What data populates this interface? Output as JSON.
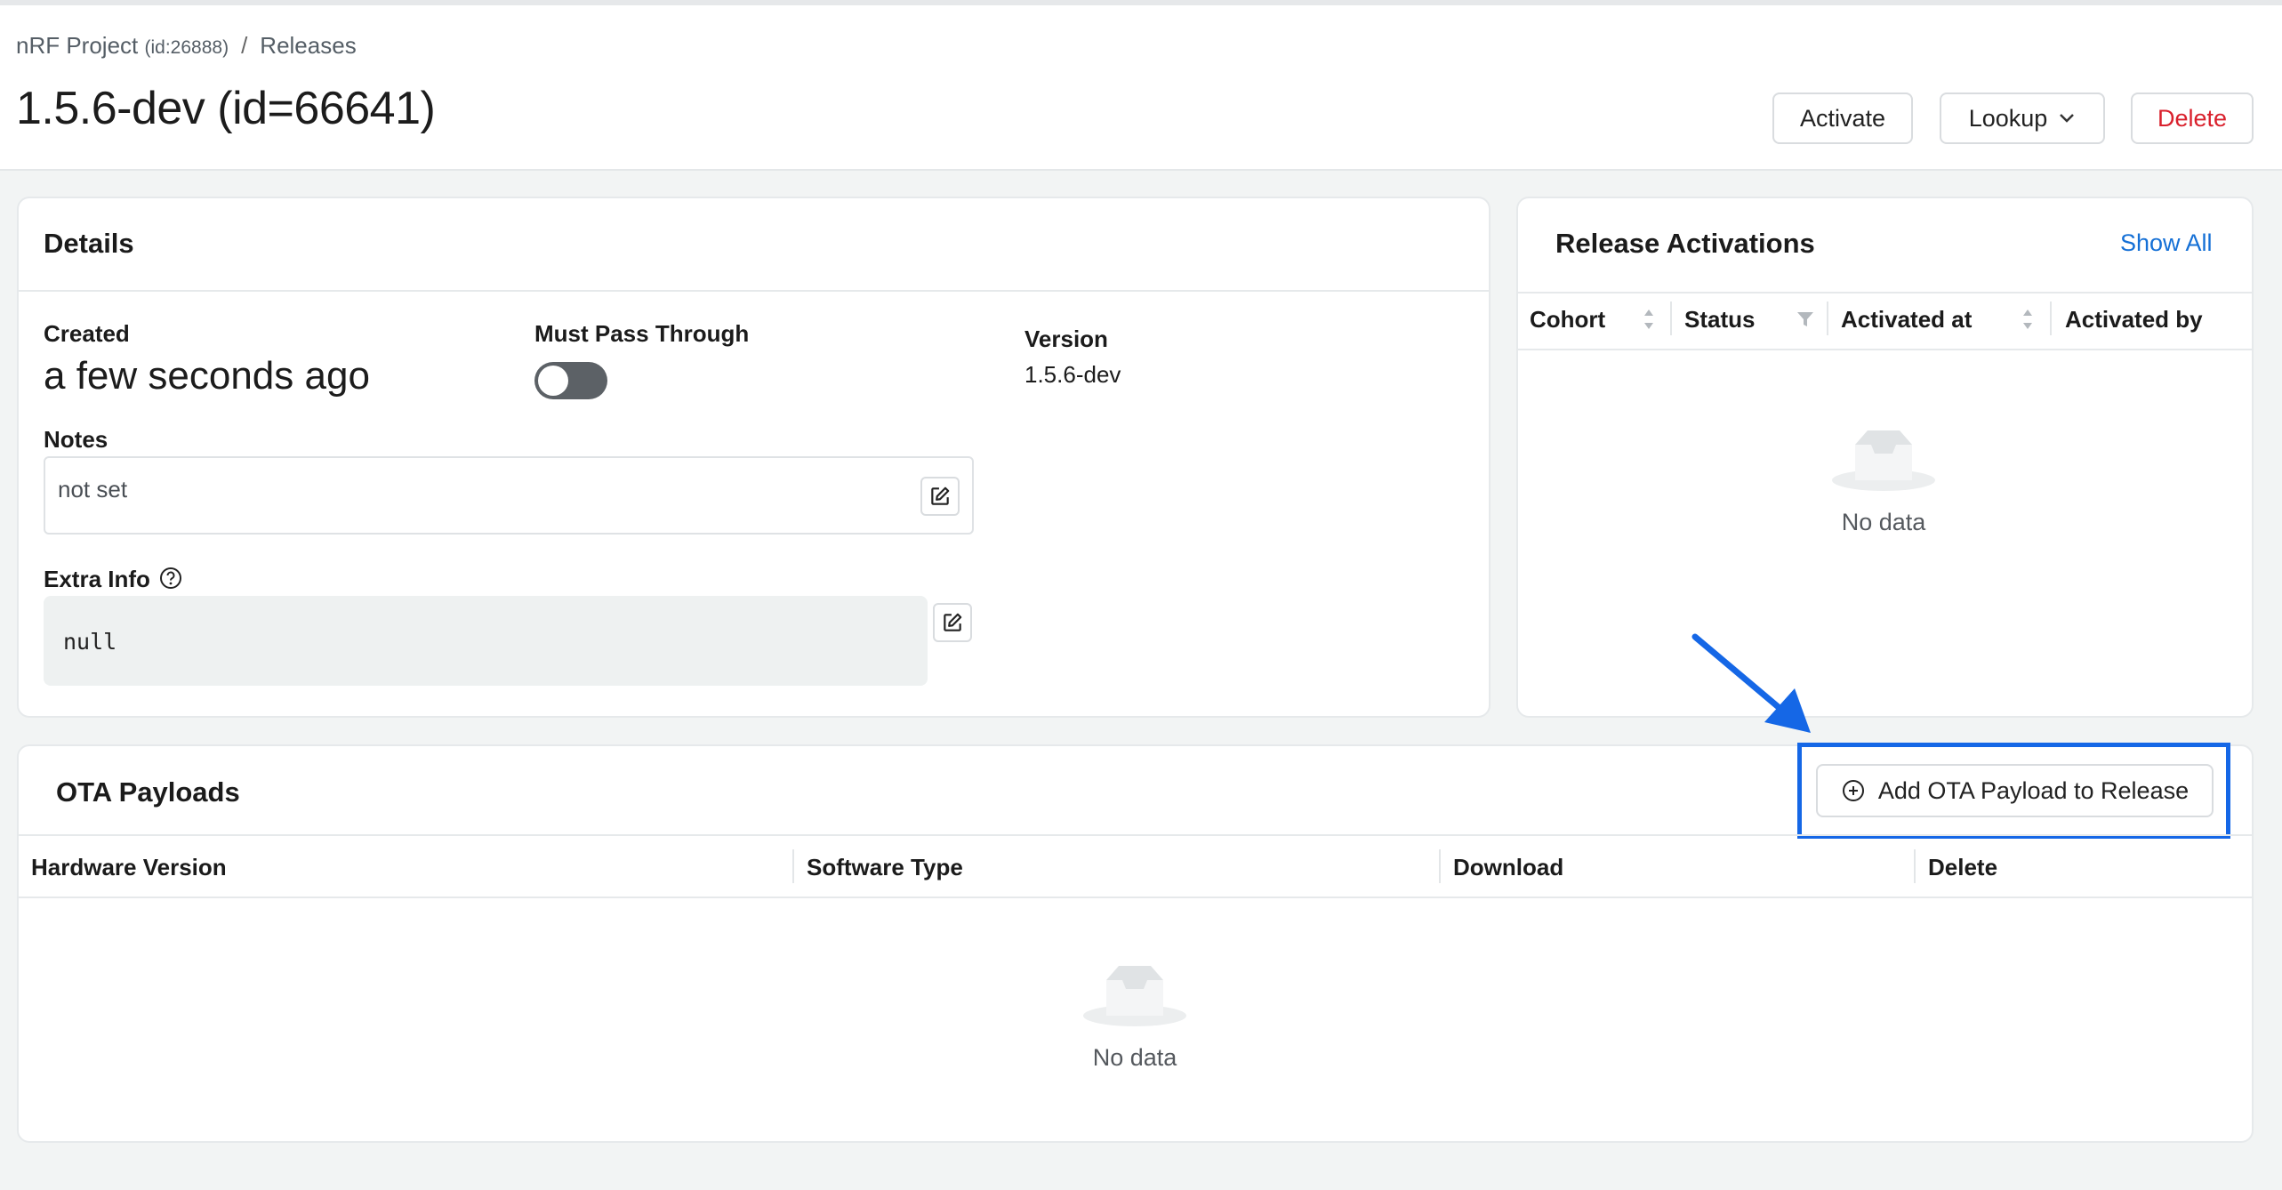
{
  "breadcrumb": {
    "project": "nRF Project",
    "project_id": "(id:26888)",
    "separator": "/",
    "section": "Releases"
  },
  "page_title": "1.5.6-dev (id=66641)",
  "header_actions": {
    "activate": "Activate",
    "lookup": "Lookup",
    "delete": "Delete"
  },
  "details": {
    "title": "Details",
    "created_label": "Created",
    "created_value": "a few seconds ago",
    "must_pass_label": "Must Pass Through",
    "must_pass_value": false,
    "version_label": "Version",
    "version_value": "1.5.6-dev",
    "notes_label": "Notes",
    "notes_value": "not set",
    "extra_info_label": "Extra Info",
    "extra_info_value": "null"
  },
  "activations": {
    "title": "Release Activations",
    "show_all": "Show All",
    "columns": [
      "Cohort",
      "Status",
      "Activated at",
      "Activated by"
    ],
    "empty_text": "No data"
  },
  "ota": {
    "title": "OTA Payloads",
    "add_button": "Add OTA Payload to Release",
    "columns": [
      "Hardware Version",
      "Software Type",
      "Download",
      "Delete"
    ],
    "empty_text": "No data"
  },
  "colors": {
    "accent": "#1570d6",
    "danger": "#d9202c",
    "annotation": "#1567e6"
  }
}
